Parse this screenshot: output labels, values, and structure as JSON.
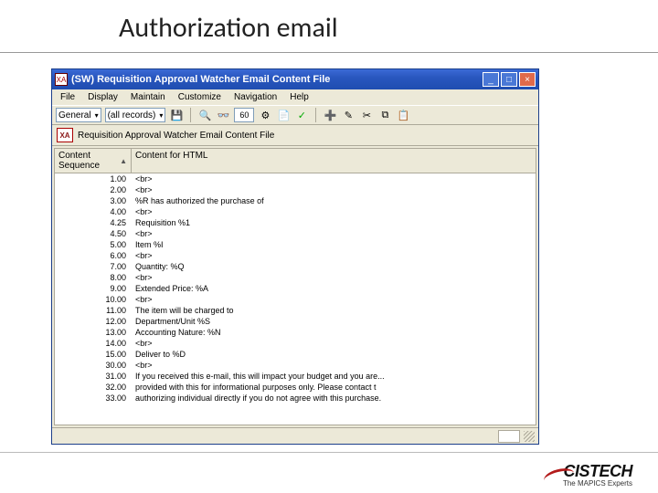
{
  "slide_title": "Authorization email",
  "window": {
    "title": "(SW) Requisition Approval Watcher Email Content File",
    "app_icon_text": "XA"
  },
  "menu": [
    "File",
    "Display",
    "Maintain",
    "Customize",
    "Navigation",
    "Help"
  ],
  "toolbar": {
    "general_label": "General",
    "records_label": "(all records)"
  },
  "icons": {
    "binoculars": "🔍",
    "glasses": "👓",
    "sixty": "60",
    "gear": "⚙",
    "paper": "📄",
    "check": "✓",
    "newdoc": "➕",
    "pencil": "✎",
    "scissors": "✂",
    "copy": "⧉",
    "paste": "📋"
  },
  "breadcrumb": {
    "icon_text": "XA",
    "text": "Requisition Approval Watcher Email Content File"
  },
  "columns": {
    "col1": "Content Sequence",
    "col2": "Content for HTML"
  },
  "rows": [
    {
      "seq": "1.00",
      "content": "<br>"
    },
    {
      "seq": "2.00",
      "content": "<br>"
    },
    {
      "seq": "3.00",
      "content": "%R    has authorized the purchase of"
    },
    {
      "seq": "4.00",
      "content": "<br>"
    },
    {
      "seq": "4.25",
      "content": "Requisition %1"
    },
    {
      "seq": "4.50",
      "content": "<br>"
    },
    {
      "seq": "5.00",
      "content": "Item %I"
    },
    {
      "seq": "6.00",
      "content": "<br>"
    },
    {
      "seq": "7.00",
      "content": "Quantity: %Q"
    },
    {
      "seq": "8.00",
      "content": "<br>"
    },
    {
      "seq": "9.00",
      "content": "Extended Price: %A"
    },
    {
      "seq": "10.00",
      "content": "<br>"
    },
    {
      "seq": "11.00",
      "content": "The item will be charged to"
    },
    {
      "seq": "12.00",
      "content": "Department/Unit %S"
    },
    {
      "seq": "13.00",
      "content": "Accounting Nature: %N"
    },
    {
      "seq": "14.00",
      "content": "<br>"
    },
    {
      "seq": "15.00",
      "content": "Deliver to  %D"
    },
    {
      "seq": "30.00",
      "content": "<br>"
    },
    {
      "seq": "31.00",
      "content": "If you received this e-mail, this will impact your budget and you are..."
    },
    {
      "seq": "32.00",
      "content": "provided with this for informational purposes only.  Please contact t"
    },
    {
      "seq": "33.00",
      "content": "authorizing individual directly if you do not agree with this purchase."
    }
  ],
  "logo": {
    "main": "CISTECH",
    "tag": "The MAPICS Experts"
  }
}
